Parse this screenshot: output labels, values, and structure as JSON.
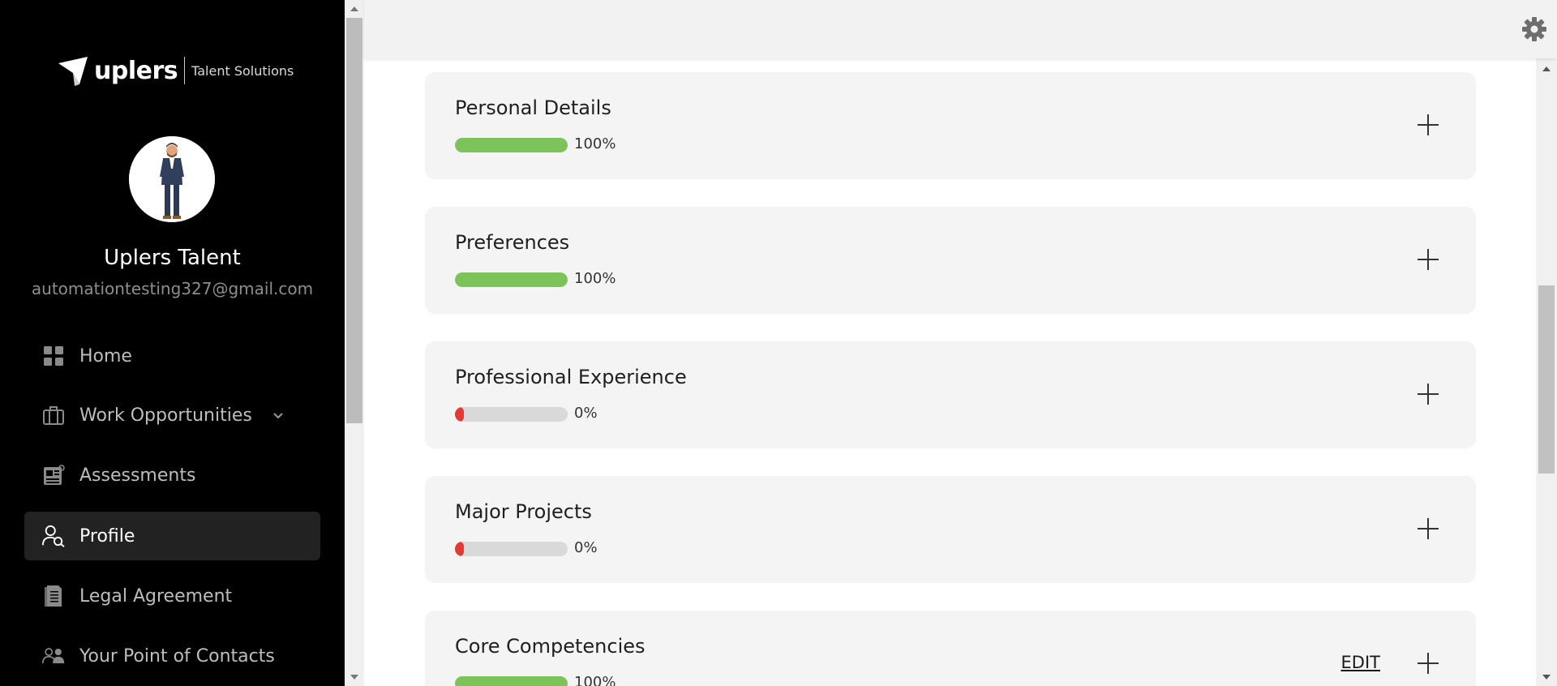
{
  "brand": {
    "logo_text": "uplers",
    "logo_subtitle": "Talent Solutions"
  },
  "user": {
    "name": "Uplers Talent",
    "email": "automationtesting327@gmail.com"
  },
  "sidebar": {
    "items": [
      {
        "label": "Home",
        "icon": "grid-icon",
        "active": false
      },
      {
        "label": "Work Opportunities",
        "icon": "briefcase-icon",
        "active": false,
        "has_dropdown": true
      },
      {
        "label": "Assessments",
        "icon": "assessment-icon",
        "active": false
      },
      {
        "label": "Profile",
        "icon": "profile-search-icon",
        "active": true
      },
      {
        "label": "Legal Agreement",
        "icon": "document-icon",
        "active": false
      },
      {
        "label": "Your Point of Contacts",
        "icon": "contacts-icon",
        "active": false
      }
    ]
  },
  "header": {
    "settings_icon": "gear-icon"
  },
  "sections": [
    {
      "title": "Personal Details",
      "progress": 100,
      "progress_label": "100%",
      "status_color": "#7cc45a"
    },
    {
      "title": "Preferences",
      "progress": 100,
      "progress_label": "100%",
      "status_color": "#7cc45a"
    },
    {
      "title": "Professional Experience",
      "progress": 0,
      "progress_label": "0%",
      "status_color": "#e53935"
    },
    {
      "title": "Major Projects",
      "progress": 0,
      "progress_label": "0%",
      "status_color": "#e53935"
    },
    {
      "title": "Core Competencies",
      "progress": 100,
      "progress_label": "100%",
      "status_color": "#7cc45a",
      "edit_label": "EDIT"
    }
  ],
  "colors": {
    "sidebar_bg": "#000000",
    "active_item_bg": "#222222",
    "progress_complete": "#7cc45a",
    "progress_empty": "#e53935",
    "card_bg": "#f4f4f4"
  }
}
